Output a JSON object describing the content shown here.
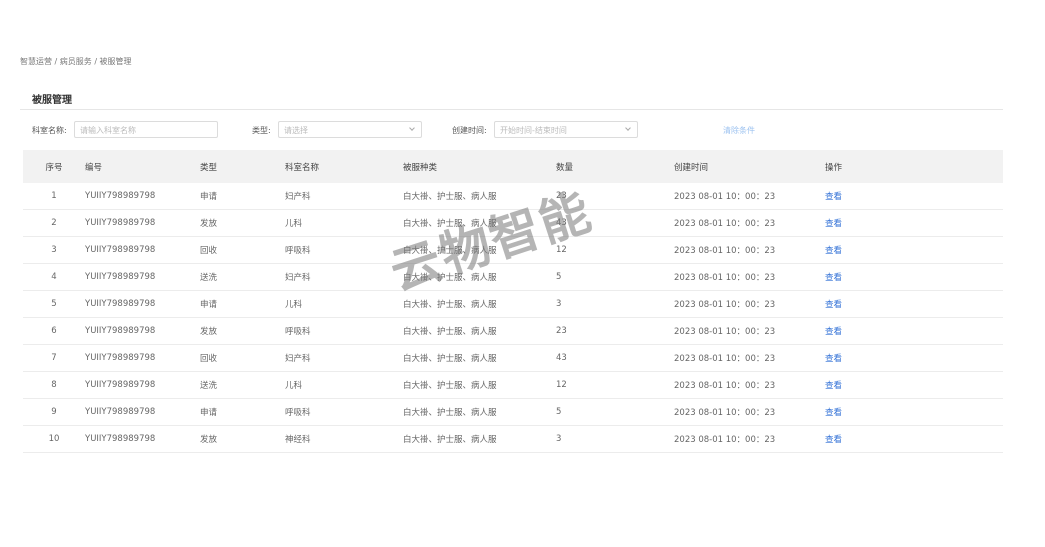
{
  "breadcrumb": "智慧运营 / 病员服务 / 被服管理",
  "title": "被服管理",
  "filters": {
    "dept_label": "科室名称:",
    "dept_placeholder": "请输入科室名称",
    "type_label": "类型:",
    "type_placeholder": "请选择",
    "time_label": "创建时间:",
    "time_placeholder": "开始时间-结束时间",
    "clear_label": "清除条件"
  },
  "table": {
    "headers": [
      "序号",
      "编号",
      "类型",
      "科室名称",
      "被服种类",
      "数量",
      "创建时间",
      "操作"
    ],
    "rows": [
      [
        "1",
        "YUIIY798989798",
        "申请",
        "妇产科",
        "白大褂、护士服、病人服",
        "23",
        "2023 08-01 10：00：23",
        "查看"
      ],
      [
        "2",
        "YUIIY798989798",
        "发放",
        "儿科",
        "白大褂、护士服、病人服",
        "43",
        "2023 08-01 10：00：23",
        "查看"
      ],
      [
        "3",
        "YUIIY798989798",
        "回收",
        "呼吸科",
        "白大褂、护士服、病人服",
        "12",
        "2023 08-01 10：00：23",
        "查看"
      ],
      [
        "4",
        "YUIIY798989798",
        "送洗",
        "妇产科",
        "白大褂、护士服、病人服",
        "5",
        "2023 08-01 10：00：23",
        "查看"
      ],
      [
        "5",
        "YUIIY798989798",
        "申请",
        "儿科",
        "白大褂、护士服、病人服",
        "3",
        "2023 08-01 10：00：23",
        "查看"
      ],
      [
        "6",
        "YUIIY798989798",
        "发放",
        "呼吸科",
        "白大褂、护士服、病人服",
        "23",
        "2023 08-01 10：00：23",
        "查看"
      ],
      [
        "7",
        "YUIIY798989798",
        "回收",
        "妇产科",
        "白大褂、护士服、病人服",
        "43",
        "2023 08-01 10：00：23",
        "查看"
      ],
      [
        "8",
        "YUIIY798989798",
        "送洗",
        "儿科",
        "白大褂、护士服、病人服",
        "12",
        "2023 08-01 10：00：23",
        "查看"
      ],
      [
        "9",
        "YUIIY798989798",
        "申请",
        "呼吸科",
        "白大褂、护士服、病人服",
        "5",
        "2023 08-01 10：00：23",
        "查看"
      ],
      [
        "10",
        "YUIIY798989798",
        "发放",
        "神经科",
        "白大褂、护士服、病人服",
        "3",
        "2023 08-01 10：00：23",
        "查看"
      ]
    ]
  },
  "watermark": "云物智能",
  "colors": {
    "link": "#2f6fd6",
    "clear": "#9ec3f0",
    "header_bg": "#f2f2f2"
  }
}
